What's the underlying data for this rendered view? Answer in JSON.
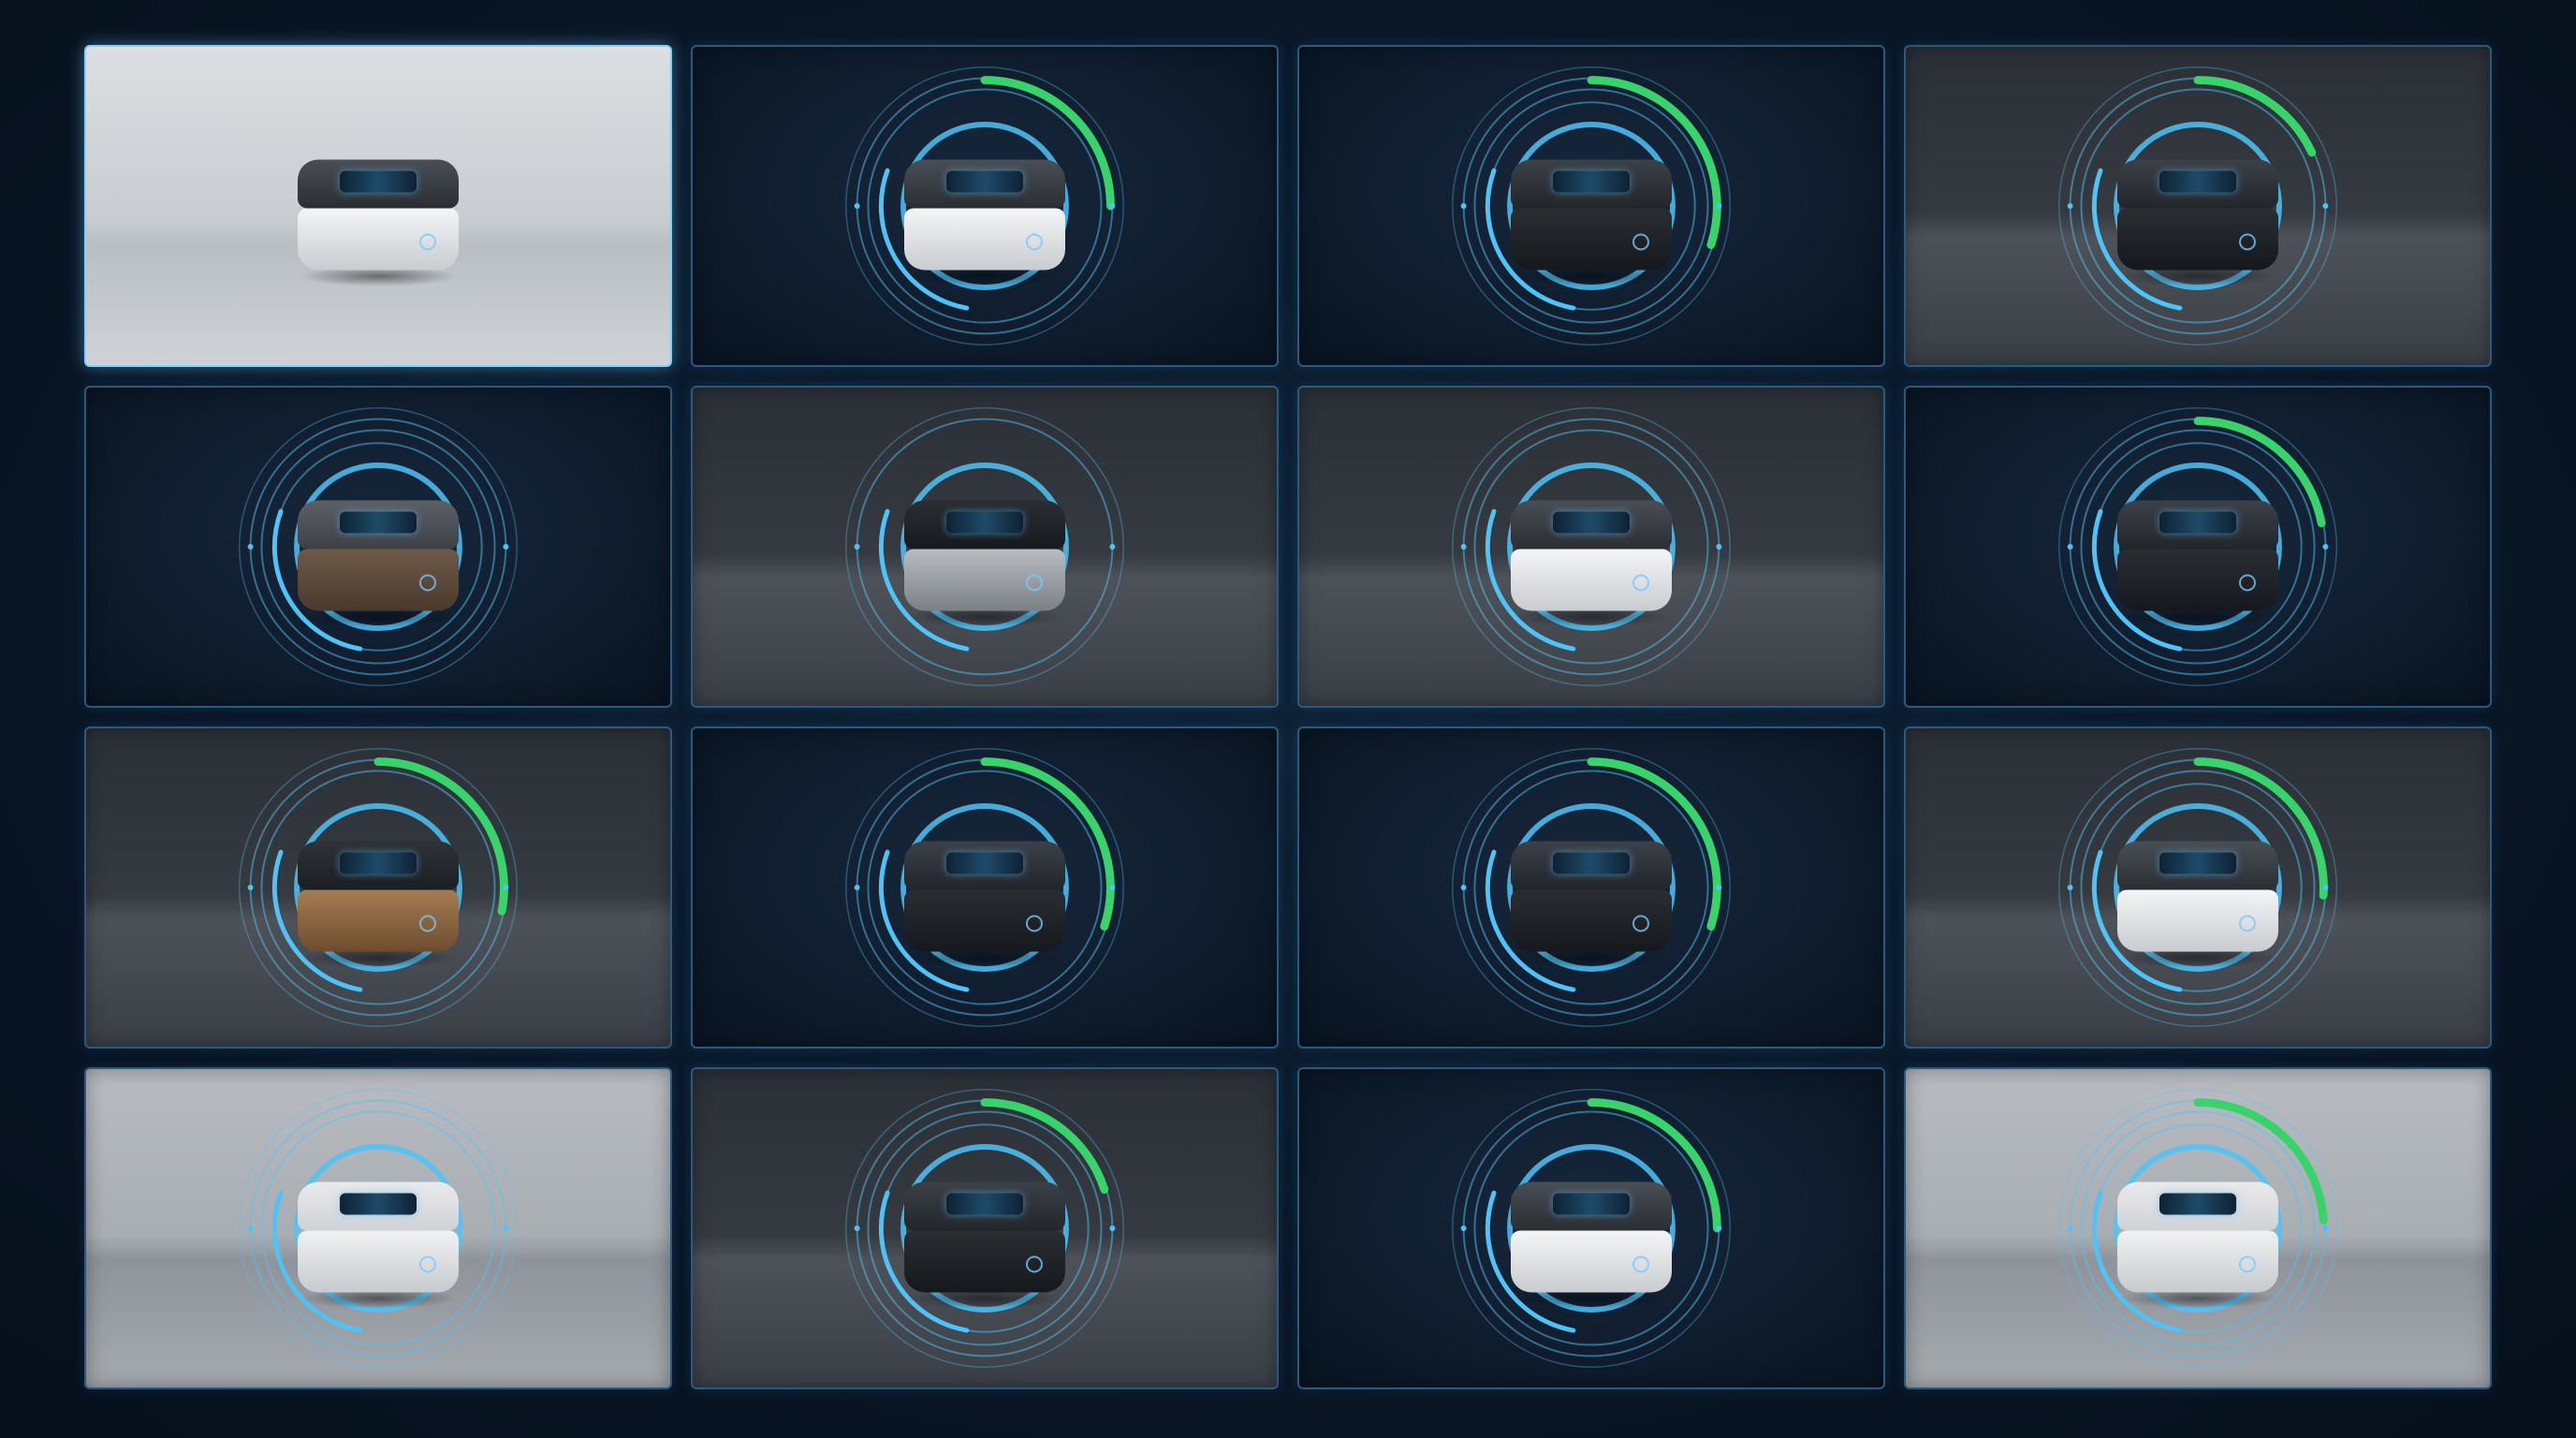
{
  "gallery": {
    "accent_color": "#4fc3f7",
    "progress_color": "#39d36b",
    "selected_index": 0,
    "tiles": [
      {
        "background": "light",
        "finish": "white",
        "hud": false,
        "progress": 0,
        "rings": 0
      },
      {
        "background": "navy",
        "finish": "white",
        "hud": true,
        "progress": 0.25,
        "rings": 3
      },
      {
        "background": "navy",
        "finish": "dark",
        "hud": true,
        "progress": 0.3,
        "rings": 4
      },
      {
        "background": "studio",
        "finish": "dark",
        "hud": true,
        "progress": 0.18,
        "rings": 3
      },
      {
        "background": "navy",
        "finish": "grey",
        "hud": true,
        "progress": 0,
        "rings": 4
      },
      {
        "background": "studio",
        "finish": "silver",
        "hud": true,
        "progress": 0,
        "rings": 2
      },
      {
        "background": "studio",
        "finish": "white",
        "hud": true,
        "progress": 0,
        "rings": 3
      },
      {
        "background": "navy",
        "finish": "dark",
        "hud": true,
        "progress": 0.22,
        "rings": 4
      },
      {
        "background": "studio",
        "finish": "wood",
        "hud": true,
        "progress": 0.28,
        "rings": 3
      },
      {
        "background": "navy",
        "finish": "dark",
        "hud": true,
        "progress": 0.3,
        "rings": 3
      },
      {
        "background": "navy",
        "finish": "dark",
        "hud": true,
        "progress": 0.3,
        "rings": 3
      },
      {
        "background": "studio",
        "finish": "white",
        "hud": true,
        "progress": 0.26,
        "rings": 4
      },
      {
        "background": "silver",
        "finish": "cream",
        "hud": true,
        "progress": 0,
        "rings": 3
      },
      {
        "background": "studio",
        "finish": "dark",
        "hud": true,
        "progress": 0.2,
        "rings": 4
      },
      {
        "background": "navy",
        "finish": "white",
        "hud": true,
        "progress": 0.25,
        "rings": 3
      },
      {
        "background": "silver",
        "finish": "cream",
        "hud": true,
        "progress": 0.24,
        "rings": 4
      }
    ]
  }
}
